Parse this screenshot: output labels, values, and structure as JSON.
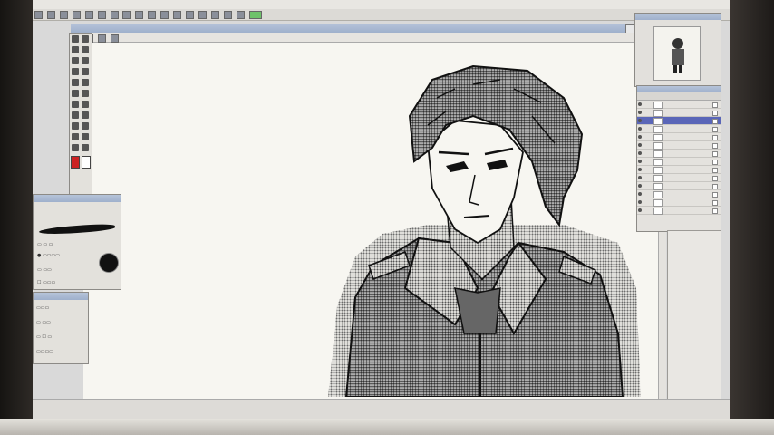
{
  "screen": {
    "app_title": "",
    "document_title": "",
    "status_text": "",
    "bottom_right_label": ""
  },
  "monitor": {
    "brand": ""
  },
  "tool_palette": {
    "colors": {
      "main": "#111111",
      "sub": "#ffffff",
      "accent": "#cc2222"
    }
  },
  "option_palette": {
    "title": ""
  },
  "layer_palette": {
    "layers": [
      {
        "label": "",
        "selected": false
      },
      {
        "label": "",
        "selected": false
      },
      {
        "label": "",
        "selected": true
      },
      {
        "label": "",
        "selected": false
      },
      {
        "label": "",
        "selected": false
      },
      {
        "label": "",
        "selected": false
      },
      {
        "label": "",
        "selected": false
      },
      {
        "label": "",
        "selected": false
      },
      {
        "label": "",
        "selected": false
      },
      {
        "label": "",
        "selected": false
      },
      {
        "label": "",
        "selected": false
      },
      {
        "label": "",
        "selected": false
      },
      {
        "label": "",
        "selected": false
      },
      {
        "label": "",
        "selected": false
      }
    ]
  },
  "colors": {
    "titlebar": "#a8b8d2",
    "selection": "#5a66b8",
    "close": "#e05a4a",
    "canvas": "#f7f6f1"
  }
}
